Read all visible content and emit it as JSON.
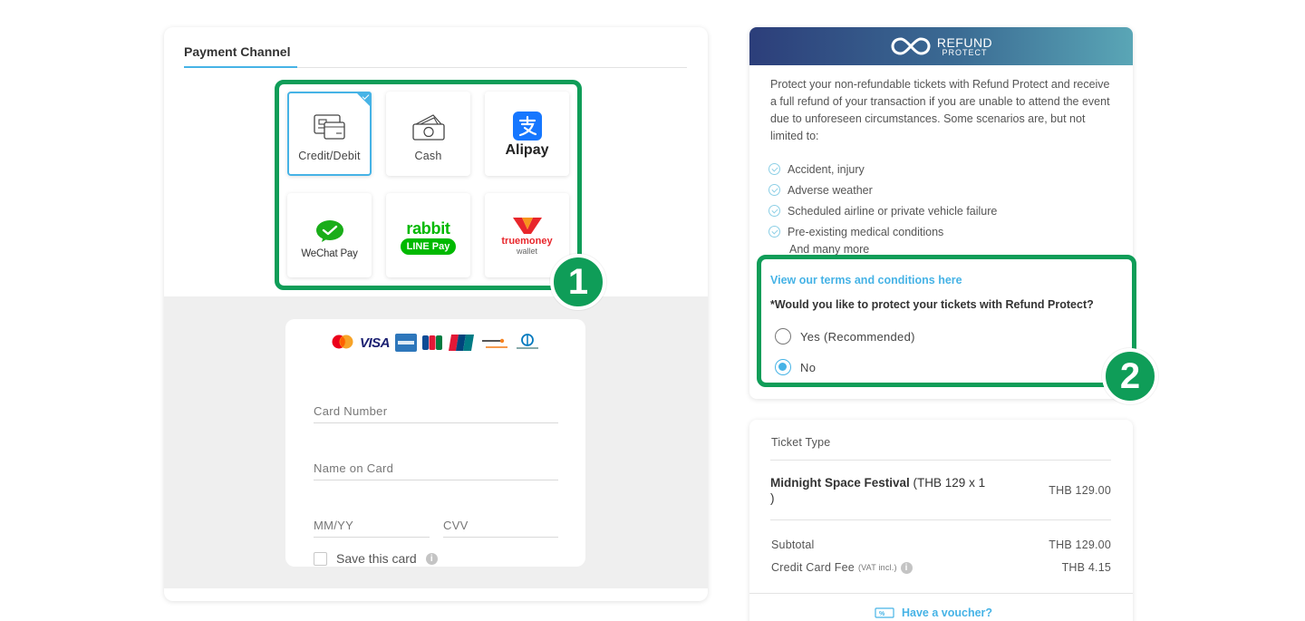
{
  "payment": {
    "tab_label": "Payment Channel",
    "methods": [
      {
        "label": "Credit/Debit",
        "selected": true,
        "icon": "credit-card-icon"
      },
      {
        "label": "Cash",
        "selected": false,
        "icon": "cash-icon"
      },
      {
        "label": "Alipay",
        "selected": false,
        "icon": "alipay-logo"
      },
      {
        "label": "WeChat Pay",
        "selected": false,
        "icon": "wechat-pay-logo"
      },
      {
        "label": "rabbit LINE Pay",
        "logo_top": "rabbit",
        "logo_bottom": "LINE Pay",
        "selected": false,
        "icon": "rabbit-line-pay-logo"
      },
      {
        "label": "truemoney wallet",
        "logo_top": "truemoney",
        "logo_bottom": "wallet",
        "selected": false,
        "icon": "truemoney-wallet-logo"
      }
    ],
    "card_brands": [
      "VISA"
    ],
    "card_number_placeholder": "Card Number",
    "name_placeholder": "Name on Card",
    "expiry_placeholder": "MM/YY",
    "cvv_placeholder": "CVV",
    "save_card_label": "Save this card",
    "callout_number": "1"
  },
  "refund": {
    "logo_line1": "REFUND",
    "logo_line2": "PROTECT",
    "description": "Protect your non-refundable tickets with Refund Protect and receive a full refund of your transaction if you are unable to attend the event due to unforeseen circumstances. Some scenarios are, but not limited to:",
    "reasons": [
      "Accident, injury",
      "Adverse weather",
      "Scheduled airline or private vehicle failure",
      "Pre-existing medical conditions"
    ],
    "more": "And many more",
    "terms_link": "View our terms and conditions here",
    "question": "*Would you like to protect your tickets with Refund Protect?",
    "option_yes": "Yes (Recommended)",
    "option_no": "No",
    "selected_option": "No",
    "callout_number": "2"
  },
  "summary": {
    "ticket_type_label": "Ticket Type",
    "item_name": "Midnight Space Festival",
    "item_detail": "(THB 129 x 1",
    "item_detail_end": ")",
    "item_price": "THB 129.00",
    "subtotal_label": "Subtotal",
    "subtotal_value": "THB 129.00",
    "fee_label": "Credit Card Fee",
    "fee_note": "(VAT incl.)",
    "fee_value": "THB 4.15",
    "voucher_label": "Have a voucher?"
  },
  "colors": {
    "accent": "#46b3e6",
    "callout": "#0f9d58",
    "header_start": "#2c3e7a",
    "header_end": "#5aa6b6"
  }
}
